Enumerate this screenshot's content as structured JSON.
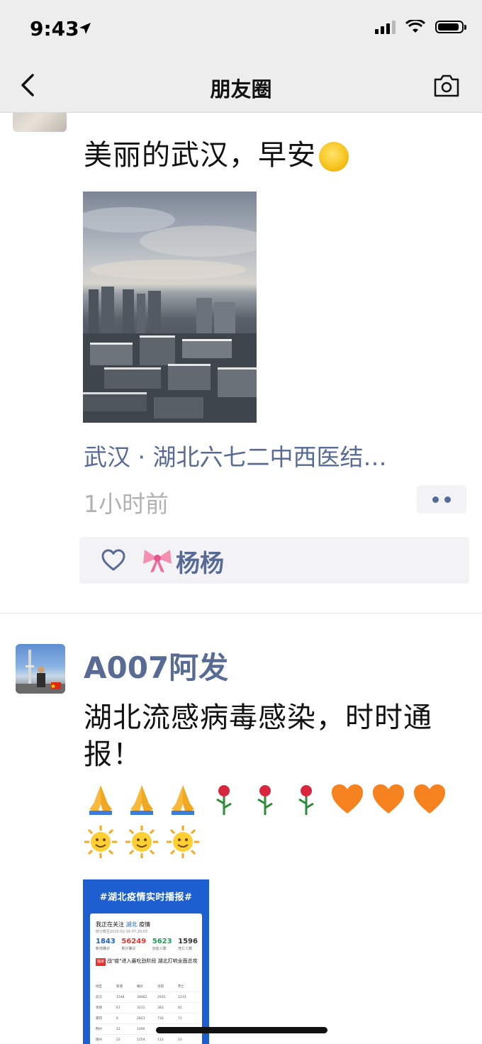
{
  "status_bar": {
    "time": "9:43"
  },
  "nav": {
    "title": "朋友圈"
  },
  "post1": {
    "text": "美丽的武汉，早安",
    "location": "武汉 · 湖北六七二中西医结…",
    "time_ago": "1小时前",
    "likes": [
      "杨杨"
    ]
  },
  "post2": {
    "username": "A007阿发",
    "text": "湖北流感病毒感染，时时通报！",
    "emoji_row1": [
      "folded-hands",
      "folded-hands",
      "folded-hands",
      "rose",
      "rose",
      "rose",
      "orange-heart",
      "orange-heart",
      "orange-heart"
    ],
    "emoji_row2": [
      "sun-face",
      "sun-face",
      "sun-face"
    ],
    "card": {
      "title": "#湖北疫情实时播报#",
      "watching_prefix": "我正在关注",
      "watching_place": "湖北",
      "watching_suffix": "疫情",
      "stat_time": "统计截至2020-02-16 07:20:03",
      "stats": [
        {
          "value": "1843",
          "label": "新增确诊",
          "color": "#1d5fd0"
        },
        {
          "value": "56249",
          "label": "累计确诊",
          "color": "#e3342f"
        },
        {
          "value": "5623",
          "label": "治愈人数",
          "color": "#1a9c55"
        },
        {
          "value": "1596",
          "label": "死亡人数",
          "color": "#333333"
        }
      ],
      "headline_tag": "独家",
      "headline": "战\"疫\"进入最吃劲阶段 湖北打响全面总攻",
      "table_header": [
        "地区",
        "新增",
        "确诊",
        "治愈",
        "死亡"
      ],
      "table_rows": [
        [
          "武汉",
          "1548",
          "39462",
          "2915",
          "1233"
        ],
        [
          "孝感",
          "67",
          "3231",
          "383",
          "65"
        ],
        [
          "黄冈",
          "6",
          "2823",
          "716",
          "71"
        ],
        [
          "荆州",
          "12",
          "1490",
          "",
          ""
        ],
        [
          "随州",
          "22",
          "1254",
          "113",
          "23"
        ]
      ]
    }
  },
  "colors": {
    "link": "#576b95",
    "meta": "#b2b2b2",
    "nav_bg": "#ededed"
  }
}
